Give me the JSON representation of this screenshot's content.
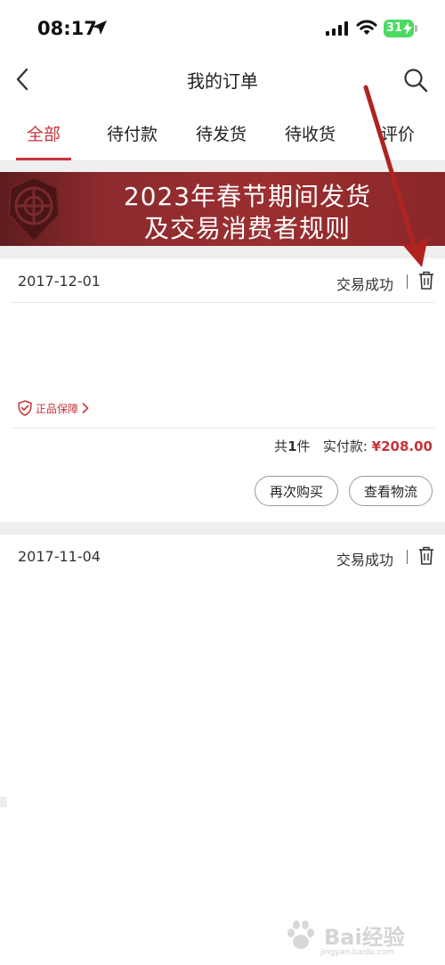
{
  "status_bar": {
    "time": "08:17",
    "battery": "31"
  },
  "nav": {
    "title": "我的订单"
  },
  "tabs": [
    {
      "label": "全部"
    },
    {
      "label": "待付款"
    },
    {
      "label": "待发货"
    },
    {
      "label": "待收货"
    },
    {
      "label": "评价"
    }
  ],
  "banner": {
    "line1": "2023年春节期间发货",
    "line2": "及交易消费者规则"
  },
  "orders": [
    {
      "date": "2017-12-01",
      "status": "交易成功",
      "guarantee": "正品保障",
      "count_prefix": "共",
      "count": "1",
      "count_suffix": "件",
      "paid_label": "实付款:",
      "paid_amount": "¥208.00",
      "buttons": {
        "rebuy": "再次购买",
        "logistics": "查看物流"
      }
    },
    {
      "date": "2017-11-04",
      "status": "交易成功"
    }
  ],
  "watermark": {
    "text": "Bai经验",
    "sub": "jingyan.baidu.com"
  },
  "colors": {
    "accent": "#c8333b",
    "banner": "#9b2f31",
    "arrow": "#b0231f"
  }
}
